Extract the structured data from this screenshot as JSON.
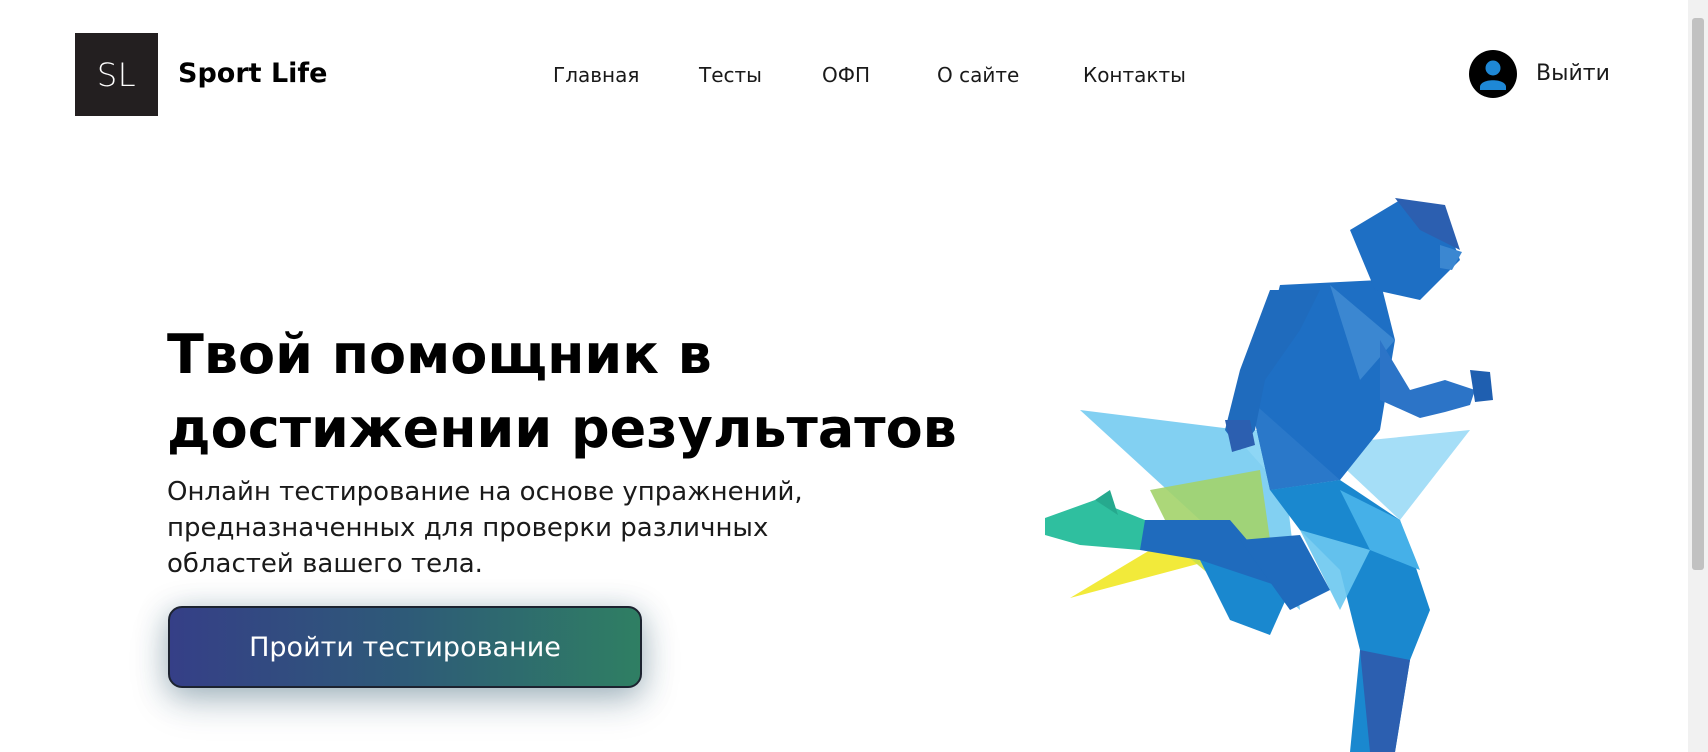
{
  "header": {
    "logo_text": "SL",
    "brand_name": "Sport Life",
    "nav": [
      {
        "label": "Главная"
      },
      {
        "label": "Тесты"
      },
      {
        "label": "ОФП"
      },
      {
        "label": "О сайте"
      },
      {
        "label": "Контакты"
      }
    ],
    "avatar_icon": "user-avatar-icon",
    "logout_label": "Выйти"
  },
  "hero": {
    "title_lines": [
      "Твой помощник в",
      "достижении результатов"
    ],
    "subtitle_lines": [
      "Онлайн тестирование на основе упражнений,",
      "предназначенных для проверки различных",
      "областей вашего тела."
    ],
    "cta_label": "Пройти тестирование",
    "illustration": "running-man-illustration"
  },
  "colors": {
    "logo_bg": "#231f20",
    "cta_gradient_start": "#353f87",
    "cta_gradient_end": "#2f7f63",
    "runner_blue": "#1e6fc4",
    "accent_yellow": "#f2ea3a",
    "accent_teal": "#2fbf9f"
  }
}
